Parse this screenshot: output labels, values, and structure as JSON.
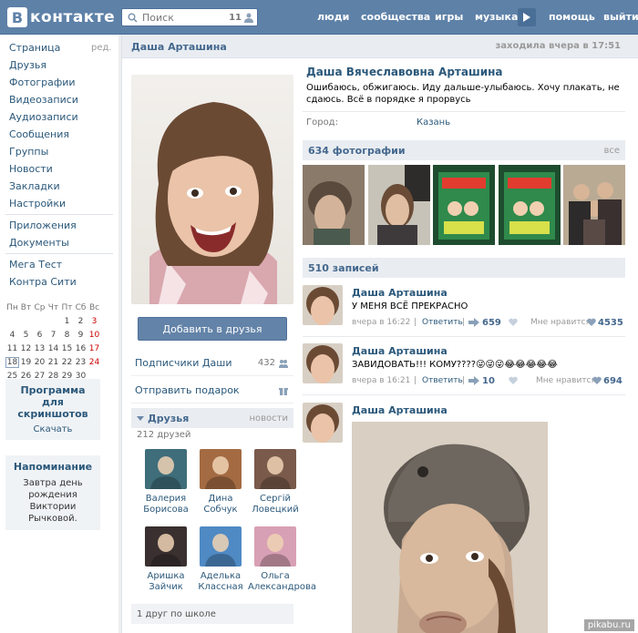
{
  "header": {
    "logo_badge": "B",
    "logo_text": "контакте",
    "search_placeholder": "Поиск",
    "search_count": "11",
    "nav": [
      "люди",
      "сообщества",
      "игры",
      "музыка",
      "помощь",
      "выйти"
    ]
  },
  "sidebar": {
    "items": [
      "Страница",
      "Друзья",
      "Фотографии",
      "Видеозаписи",
      "Аудиозаписи",
      "Сообщения",
      "Группы",
      "Новости",
      "Закладки",
      "Настройки"
    ],
    "edit_label": "ред.",
    "apps": [
      "Приложения",
      "Документы"
    ],
    "extra": [
      "Мега Тест",
      "Контра Сити"
    ],
    "calendar": {
      "head": [
        "Пн",
        "Вт",
        "Ср",
        "Чт",
        "Пт",
        "Сб",
        "Вс"
      ],
      "rows": [
        [
          "",
          "",
          "",
          "",
          "1",
          "2",
          "3"
        ],
        [
          "4",
          "5",
          "6",
          "7",
          "8",
          "9",
          "10"
        ],
        [
          "11",
          "12",
          "13",
          "14",
          "15",
          "16",
          "17"
        ],
        [
          "18",
          "19",
          "20",
          "21",
          "22",
          "23",
          "24"
        ],
        [
          "25",
          "26",
          "27",
          "28",
          "29",
          "30",
          ""
        ]
      ],
      "today": "18"
    },
    "promo": {
      "title": "Программа для скриншотов",
      "link": "Скачать"
    },
    "reminder": {
      "title": "Напоминание",
      "text": "Завтра день рождения Виктории Рычковой."
    }
  },
  "profile": {
    "short_name": "Даша Арташина",
    "last_seen": "заходила вчера в 17:51",
    "full_name": "Даша Вячеславовна Арташина",
    "status": "Ошибаюсь, обжигаюсь. Иду дальше-улыбаюсь. Хочу плакать, не сдаюсь. Всё в порядке я прорвусь",
    "city_label": "Город:",
    "city_value": "Казань",
    "add_friend": "Добавить в друзья",
    "subscribers_label": "Подписчики Даши",
    "subscribers_count": "432",
    "gift_label": "Отправить подарок",
    "friends_title": "Друзья",
    "friends_news": "новости",
    "friends_count": "212 друзей",
    "friends": [
      {
        "first": "Валерия",
        "last": "Борисова",
        "color": "#3f6d7a"
      },
      {
        "first": "Дина",
        "last": "Собчук",
        "color": "#a46b43"
      },
      {
        "first": "Сергій",
        "last": "Ловецкий",
        "color": "#7a5a4a"
      },
      {
        "first": "Аришка",
        "last": "Зайчик",
        "color": "#3a3030"
      },
      {
        "first": "Аделька",
        "last": "Классная",
        "color": "#4f8ac4"
      },
      {
        "first": "Ольга",
        "last": "Александрова",
        "color": "#d8a0b4"
      }
    ],
    "school": "1 друг по школе"
  },
  "photos_section": {
    "title": "634 фотографии",
    "all": "все"
  },
  "wall": {
    "title": "510 записей",
    "posts": [
      {
        "author": "Даша Арташина",
        "text": "У МЕНЯ ВСЁ ПРЕКРАСНО",
        "time": "вчера в 16:22",
        "reply": "Ответить",
        "reposts": "659",
        "likes_label": "Мне нравится",
        "likes": "4535"
      },
      {
        "author": "Даша Арташина",
        "text": "ЗАВИДОВАТЬ!!! КОМУ????",
        "emoji": "😜😜😜😂😂😂😂😂",
        "time": "вчера в 16:21",
        "reply": "Ответить",
        "reposts": "10",
        "likes_label": "Мне нравится",
        "likes": "694"
      },
      {
        "author": "Даша Арташина"
      }
    ]
  },
  "watermark": "pikabu.ru"
}
